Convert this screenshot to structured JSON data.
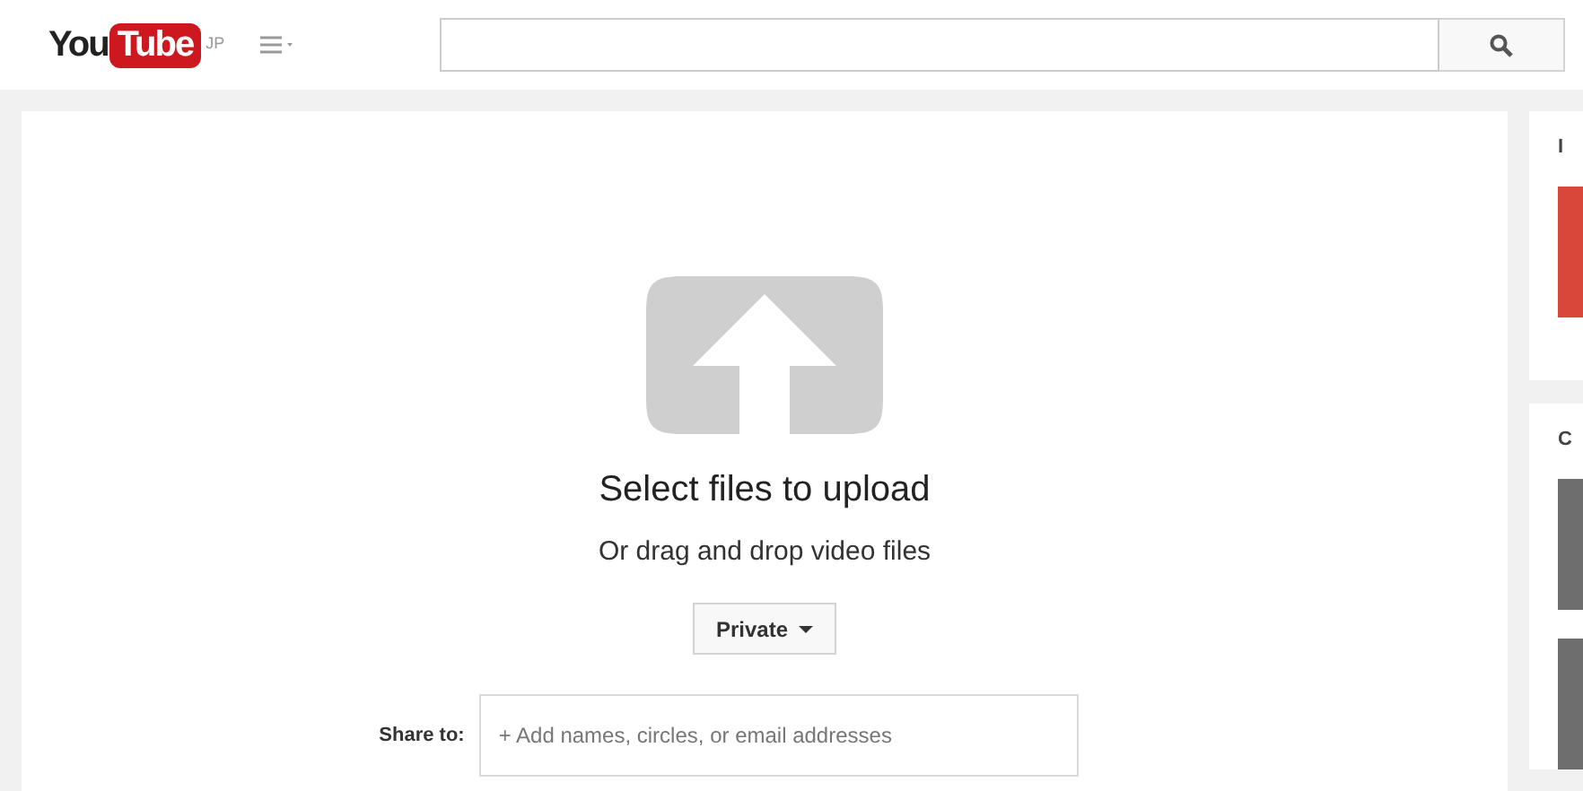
{
  "header": {
    "logo": {
      "you": "You",
      "tube": "Tube",
      "region": "JP"
    }
  },
  "upload": {
    "title": "Select files to upload",
    "subtitle": "Or drag and drop video files",
    "privacy": "Private",
    "share_label": "Share to:",
    "share_placeholder": "+ Add names, circles, or email addresses"
  },
  "sidebar": [
    {
      "heading": "I",
      "tiles": [
        {
          "color": "#d9463a"
        }
      ]
    },
    {
      "heading": "C",
      "tiles": [
        {
          "color": "#6e6e6e"
        },
        {
          "color": "#6e6e6e"
        }
      ]
    }
  ]
}
